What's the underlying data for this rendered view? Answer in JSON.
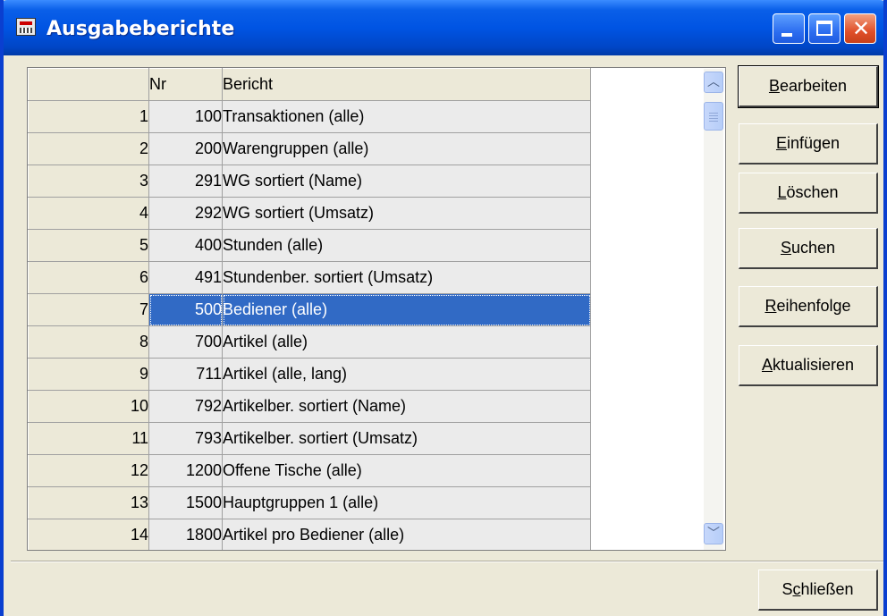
{
  "window": {
    "title": "Ausgabeberichte"
  },
  "titlebar_buttons": {
    "minimize": "minimize-icon",
    "maximize": "maximize-icon",
    "close": "close-icon",
    "close_glyph": "✕"
  },
  "grid": {
    "columns": [
      "",
      "Nr",
      "Bericht"
    ],
    "selected_row": 7,
    "rows": [
      {
        "row": "1",
        "nr": "100",
        "bericht": "Transaktionen (alle)"
      },
      {
        "row": "2",
        "nr": "200",
        "bericht": "Warengruppen (alle)"
      },
      {
        "row": "3",
        "nr": "291",
        "bericht": "WG sortiert (Name)"
      },
      {
        "row": "4",
        "nr": "292",
        "bericht": "WG sortiert (Umsatz)"
      },
      {
        "row": "5",
        "nr": "400",
        "bericht": "Stunden (alle)"
      },
      {
        "row": "6",
        "nr": "491",
        "bericht": "Stundenber. sortiert (Umsatz)"
      },
      {
        "row": "7",
        "nr": "500",
        "bericht": "Bediener (alle)"
      },
      {
        "row": "8",
        "nr": "700",
        "bericht": "Artikel (alle)"
      },
      {
        "row": "9",
        "nr": "711",
        "bericht": "Artikel (alle, lang)"
      },
      {
        "row": "10",
        "nr": "792",
        "bericht": "Artikelber. sortiert (Name)"
      },
      {
        "row": "11",
        "nr": "793",
        "bericht": "Artikelber. sortiert (Umsatz)"
      },
      {
        "row": "12",
        "nr": "1200",
        "bericht": "Offene Tische (alle)"
      },
      {
        "row": "13",
        "nr": "1500",
        "bericht": "Hauptgruppen 1 (alle)"
      },
      {
        "row": "14",
        "nr": "1800",
        "bericht": "Artikel pro Bediener (alle)"
      }
    ]
  },
  "scrollbar": {
    "up_glyph": "︿",
    "down_glyph": "﹀"
  },
  "buttons": {
    "bearbeiten": "Bearbeiten",
    "einfuegen": "Einfügen",
    "loeschen": "Löschen",
    "suchen": "Suchen",
    "reihenfolge": "Reihenfolge",
    "aktualisieren": "Aktualisieren",
    "schliessen": "Schließen"
  },
  "colors": {
    "titlebar": "#0054e3",
    "selection": "#316ac5",
    "face": "#ece9d8"
  }
}
